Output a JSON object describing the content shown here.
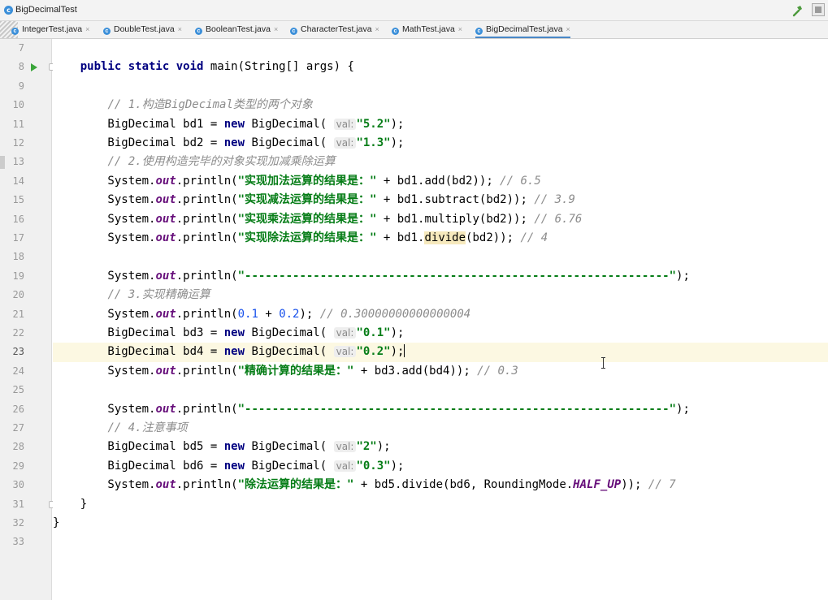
{
  "window": {
    "title": "BigDecimalTest"
  },
  "tabs": [
    {
      "label": "IntegerTest.java",
      "close": "×"
    },
    {
      "label": "DoubleTest.java",
      "close": "×"
    },
    {
      "label": "BooleanTest.java",
      "close": "×"
    },
    {
      "label": "CharacterTest.java",
      "close": "×"
    },
    {
      "label": "MathTest.java",
      "close": "×"
    },
    {
      "label": "BigDecimalTest.java",
      "close": "×",
      "active": true
    }
  ],
  "editor": {
    "current_line": 23,
    "lines": [
      {
        "n": "7",
        "t": []
      },
      {
        "n": "8",
        "t": [
          [
            "",
            "    "
          ],
          [
            "kw",
            "public static void "
          ],
          [
            "",
            "main(String[] args) {"
          ]
        ]
      },
      {
        "n": "9",
        "t": []
      },
      {
        "n": "10",
        "t": [
          [
            "",
            "        "
          ],
          [
            "cmt",
            "// 1.构造BigDecimal类型的两个对象"
          ]
        ]
      },
      {
        "n": "11",
        "t": [
          [
            "",
            "        BigDecimal bd1 = "
          ],
          [
            "kw",
            "new "
          ],
          [
            "",
            "BigDecimal( "
          ],
          [
            "hint",
            "val:"
          ],
          [
            "str",
            "\"5.2\""
          ],
          [
            "",
            ");"
          ]
        ]
      },
      {
        "n": "12",
        "t": [
          [
            "",
            "        BigDecimal bd2 = "
          ],
          [
            "kw",
            "new "
          ],
          [
            "",
            "BigDecimal( "
          ],
          [
            "hint",
            "val:"
          ],
          [
            "str",
            "\"1.3\""
          ],
          [
            "",
            ");"
          ]
        ]
      },
      {
        "n": "13",
        "t": [
          [
            "",
            "        "
          ],
          [
            "cmt",
            "// 2.使用构造完毕的对象实现加减乘除运算"
          ]
        ]
      },
      {
        "n": "14",
        "t": [
          [
            "",
            "        System."
          ],
          [
            "fld",
            "out"
          ],
          [
            "",
            ".println("
          ],
          [
            "str",
            "\"实现加法运算的结果是：\""
          ],
          [
            "",
            " + bd1.add(bd2)); "
          ],
          [
            "cmt",
            "// 6.5"
          ]
        ]
      },
      {
        "n": "15",
        "t": [
          [
            "",
            "        System."
          ],
          [
            "fld",
            "out"
          ],
          [
            "",
            ".println("
          ],
          [
            "str",
            "\"实现减法运算的结果是：\""
          ],
          [
            "",
            " + bd1.subtract(bd2)); "
          ],
          [
            "cmt",
            "// 3.9"
          ]
        ]
      },
      {
        "n": "16",
        "t": [
          [
            "",
            "        System."
          ],
          [
            "fld",
            "out"
          ],
          [
            "",
            ".println("
          ],
          [
            "str",
            "\"实现乘法运算的结果是：\""
          ],
          [
            "",
            " + bd1.multiply(bd2)); "
          ],
          [
            "cmt",
            "// 6.76"
          ]
        ]
      },
      {
        "n": "17",
        "t": [
          [
            "",
            "        System."
          ],
          [
            "fld",
            "out"
          ],
          [
            "",
            ".println("
          ],
          [
            "str",
            "\"实现除法运算的结果是：\""
          ],
          [
            "",
            " + bd1."
          ],
          [
            "hl",
            "divide"
          ],
          [
            "",
            "(bd2)); "
          ],
          [
            "cmt",
            "// 4"
          ]
        ]
      },
      {
        "n": "18",
        "t": []
      },
      {
        "n": "19",
        "t": [
          [
            "",
            "        System."
          ],
          [
            "fld",
            "out"
          ],
          [
            "",
            ".println("
          ],
          [
            "str",
            "\"--------------------------------------------------------------\""
          ],
          [
            "",
            ");"
          ]
        ]
      },
      {
        "n": "20",
        "t": [
          [
            "",
            "        "
          ],
          [
            "cmt",
            "// 3.实现精确运算"
          ]
        ]
      },
      {
        "n": "21",
        "t": [
          [
            "",
            "        System."
          ],
          [
            "fld",
            "out"
          ],
          [
            "",
            ".println("
          ],
          [
            "num",
            "0.1"
          ],
          [
            "",
            " + "
          ],
          [
            "num",
            "0.2"
          ],
          [
            "",
            "); "
          ],
          [
            "cmt",
            "// 0.30000000000000004"
          ]
        ]
      },
      {
        "n": "22",
        "t": [
          [
            "",
            "        BigDecimal bd3 = "
          ],
          [
            "kw",
            "new "
          ],
          [
            "",
            "BigDecimal( "
          ],
          [
            "hint",
            "val:"
          ],
          [
            "str",
            "\"0.1\""
          ],
          [
            "",
            ");"
          ]
        ]
      },
      {
        "n": "23",
        "t": [
          [
            "",
            "        BigDecimal bd4 = "
          ],
          [
            "kw",
            "new "
          ],
          [
            "",
            "BigDecimal( "
          ],
          [
            "hint",
            "val:"
          ],
          [
            "str",
            "\"0.2\""
          ],
          [
            "",
            ");"
          ],
          [
            "caret",
            ""
          ]
        ]
      },
      {
        "n": "24",
        "t": [
          [
            "",
            "        System."
          ],
          [
            "fld",
            "out"
          ],
          [
            "",
            ".println("
          ],
          [
            "str",
            "\"精确计算的结果是：\""
          ],
          [
            "",
            " + bd3.add(bd4)); "
          ],
          [
            "cmt",
            "// 0.3"
          ]
        ]
      },
      {
        "n": "25",
        "t": []
      },
      {
        "n": "26",
        "t": [
          [
            "",
            "        System."
          ],
          [
            "fld",
            "out"
          ],
          [
            "",
            ".println("
          ],
          [
            "str",
            "\"--------------------------------------------------------------\""
          ],
          [
            "",
            ");"
          ]
        ]
      },
      {
        "n": "27",
        "t": [
          [
            "",
            "        "
          ],
          [
            "cmt",
            "// 4.注意事项"
          ]
        ]
      },
      {
        "n": "28",
        "t": [
          [
            "",
            "        BigDecimal bd5 = "
          ],
          [
            "kw",
            "new "
          ],
          [
            "",
            "BigDecimal( "
          ],
          [
            "hint",
            "val:"
          ],
          [
            "str",
            "\"2\""
          ],
          [
            "",
            ");"
          ]
        ]
      },
      {
        "n": "29",
        "t": [
          [
            "",
            "        BigDecimal bd6 = "
          ],
          [
            "kw",
            "new "
          ],
          [
            "",
            "BigDecimal( "
          ],
          [
            "hint",
            "val:"
          ],
          [
            "str",
            "\"0.3\""
          ],
          [
            "",
            ");"
          ]
        ]
      },
      {
        "n": "30",
        "t": [
          [
            "",
            "        System."
          ],
          [
            "fld",
            "out"
          ],
          [
            "",
            ".println("
          ],
          [
            "str",
            "\"除法运算的结果是：\""
          ],
          [
            "",
            " + bd5.divide(bd6, RoundingMode."
          ],
          [
            "fld",
            "HALF_UP"
          ],
          [
            "",
            "));"
          ],
          [
            "",
            " "
          ],
          [
            "cmt",
            "// 7"
          ]
        ]
      },
      {
        "n": "31",
        "t": [
          [
            "",
            "    }"
          ]
        ]
      },
      {
        "n": "32",
        "t": [
          [
            "",
            "}"
          ]
        ]
      },
      {
        "n": "33",
        "t": []
      }
    ]
  },
  "colors": {
    "keyword": "#000080",
    "string": "#067d17",
    "number": "#1750eb",
    "comment": "#8c8c8c",
    "field": "#660e7a",
    "current_line_bg": "#fcf8e2"
  },
  "icons": {
    "app": "java-class-icon",
    "build": "hammer-icon",
    "run": "run-gutter-icon"
  }
}
